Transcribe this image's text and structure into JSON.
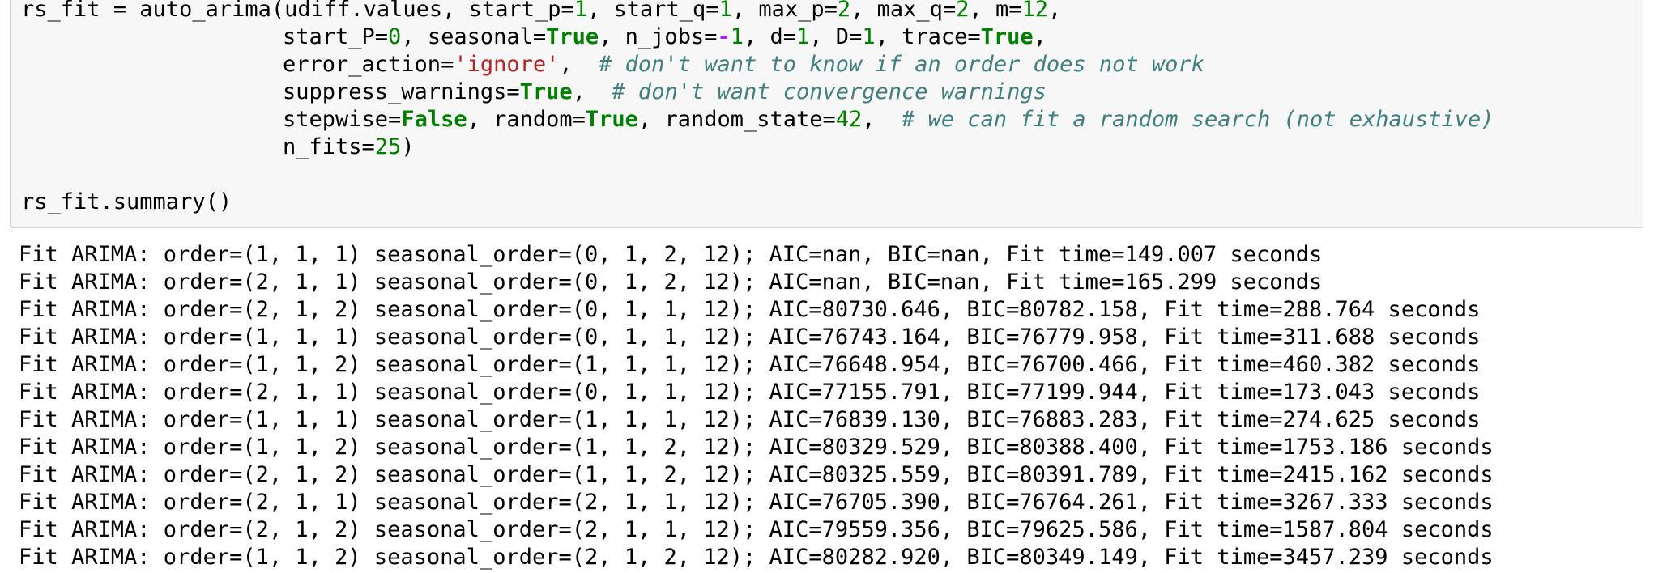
{
  "input_cell": {
    "line1": {
      "a": "rs_fit = auto_arima(udiff.values, start_p=",
      "n1": "1",
      "b": ", start_q=",
      "n2": "1",
      "c": ", max_p=",
      "n3": "2",
      "d": ", max_q=",
      "n4": "2",
      "e": ", m=",
      "n5": "12",
      "f": ","
    },
    "line2": {
      "a": "start_P=",
      "n1": "0",
      "b": ", seasonal=",
      "k1": "True",
      "c": ", n_jobs=",
      "op": "-",
      "n2": "1",
      "d": ", d=",
      "n3": "1",
      "e": ", D=",
      "n4": "1",
      "f": ", trace=",
      "k2": "True",
      "g": ","
    },
    "line3": {
      "a": "error_action=",
      "s1": "'ignore'",
      "b": ",  ",
      "c1": "# don't want to know if an order does not work"
    },
    "line4": {
      "a": "suppress_warnings=",
      "k1": "True",
      "b": ",  ",
      "c1": "# don't want convergence warnings"
    },
    "line5": {
      "a": "stepwise=",
      "k1": "False",
      "b": ", random=",
      "k2": "True",
      "c": ", random_state=",
      "n1": "42",
      "d": ",  ",
      "c1": "# we can fit a random search (not exhaustive)"
    },
    "line6": {
      "a": "n_fits=",
      "n1": "25",
      "b": ")"
    },
    "line7": "",
    "line8": "rs_fit.summary()"
  },
  "output_lines": [
    "Fit ARIMA: order=(1, 1, 1) seasonal_order=(0, 1, 2, 12); AIC=nan, BIC=nan, Fit time=149.007 seconds",
    "Fit ARIMA: order=(2, 1, 1) seasonal_order=(0, 1, 2, 12); AIC=nan, BIC=nan, Fit time=165.299 seconds",
    "Fit ARIMA: order=(2, 1, 2) seasonal_order=(0, 1, 1, 12); AIC=80730.646, BIC=80782.158, Fit time=288.764 seconds",
    "Fit ARIMA: order=(1, 1, 1) seasonal_order=(0, 1, 1, 12); AIC=76743.164, BIC=76779.958, Fit time=311.688 seconds",
    "Fit ARIMA: order=(1, 1, 2) seasonal_order=(1, 1, 1, 12); AIC=76648.954, BIC=76700.466, Fit time=460.382 seconds",
    "Fit ARIMA: order=(2, 1, 1) seasonal_order=(0, 1, 1, 12); AIC=77155.791, BIC=77199.944, Fit time=173.043 seconds",
    "Fit ARIMA: order=(1, 1, 1) seasonal_order=(1, 1, 1, 12); AIC=76839.130, BIC=76883.283, Fit time=274.625 seconds",
    "Fit ARIMA: order=(1, 1, 2) seasonal_order=(1, 1, 2, 12); AIC=80329.529, BIC=80388.400, Fit time=1753.186 seconds",
    "Fit ARIMA: order=(2, 1, 2) seasonal_order=(1, 1, 2, 12); AIC=80325.559, BIC=80391.789, Fit time=2415.162 seconds",
    "Fit ARIMA: order=(2, 1, 1) seasonal_order=(2, 1, 1, 12); AIC=76705.390, BIC=76764.261, Fit time=3267.333 seconds",
    "Fit ARIMA: order=(2, 1, 2) seasonal_order=(2, 1, 1, 12); AIC=79559.356, BIC=79625.586, Fit time=1587.804 seconds",
    "Fit ARIMA: order=(1, 1, 2) seasonal_order=(2, 1, 2, 12); AIC=80282.920, BIC=80349.149, Fit time=3457.239 seconds"
  ],
  "colors": {
    "keyword": "#008000",
    "string": "#ba2121",
    "comment": "#408080",
    "operator": "#aa22ff",
    "cell_background": "#f7f7f7",
    "cell_border": "#cfcfcf"
  }
}
